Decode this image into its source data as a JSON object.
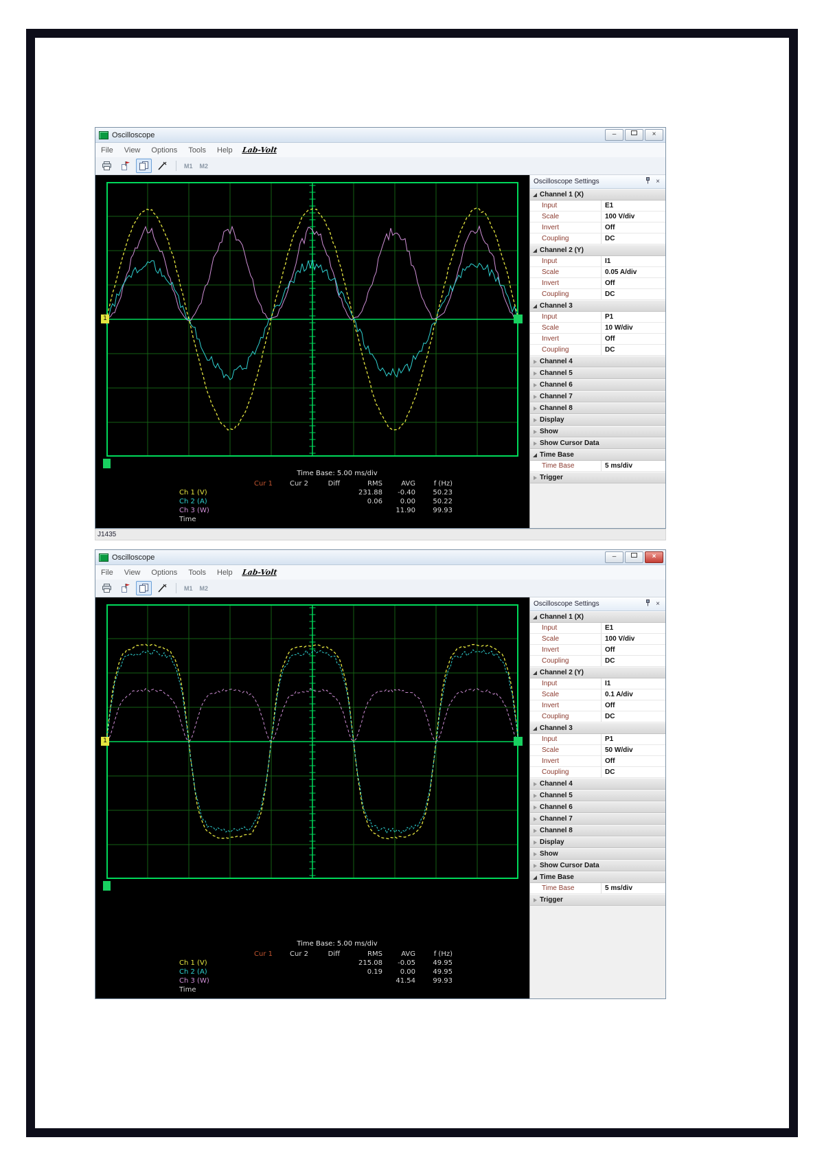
{
  "icons": {
    "minimize_glyph": "–",
    "close_glyph": "×"
  },
  "page": {
    "status_label": "J1435"
  },
  "palette": {
    "grid_bright": "#00d95a",
    "grid_dim": "#146114",
    "scope_bg": "#000000",
    "ch1_yellow": "#e6e640",
    "ch2_cyan": "#2fd0d0",
    "ch3_magenta": "#cf8fd6",
    "cursor1_orange": "#c1542f"
  },
  "windows": [
    {
      "title": "Oscilloscope",
      "menus": [
        "File",
        "View",
        "Options",
        "Tools",
        "Help"
      ],
      "logo_label": "Lab-Volt",
      "toolbar": {
        "m1_label": "M1",
        "m2_label": "M2"
      },
      "scope": {
        "trigger_marker": "1",
        "time_base_label": "Time Base: 5.00 ms/div",
        "table": {
          "headers": [
            "Cur 1",
            "Cur 2",
            "Diff",
            "RMS",
            "AVG",
            "f (Hz)"
          ],
          "rows": [
            {
              "label": "Ch 1 (V)",
              "color": "#e6e640",
              "cur1": "",
              "cur2": "",
              "diff": "",
              "rms": "231.88",
              "avg": "-0.40",
              "f": "50.23"
            },
            {
              "label": "Ch 2 (A)",
              "color": "#2fd0d0",
              "cur1": "",
              "cur2": "",
              "diff": "",
              "rms": "0.06",
              "avg": "0.00",
              "f": "50.22"
            },
            {
              "label": "Ch 3 (W)",
              "color": "#cf8fd6",
              "cur1": "",
              "cur2": "",
              "diff": "",
              "rms": "",
              "avg": "11.90",
              "f": "99.93"
            },
            {
              "label": "Time",
              "color": "#d9d9d9",
              "cur1": "",
              "cur2": "",
              "diff": "",
              "rms": "",
              "avg": "",
              "f": ""
            }
          ]
        }
      },
      "waveforms": [
        {
          "name": "ch3-power",
          "color": "#cf8fd6",
          "kind": "power",
          "amp_div": 2.6,
          "period_div": 4,
          "peak_div": 5,
          "shape_k": 0,
          "noise_div": 0.18,
          "dash": "",
          "width": 1
        },
        {
          "name": "ch2-current",
          "color": "#2fd0d0",
          "kind": "sine",
          "amp_div": 1.6,
          "period_div": 4,
          "peak_div": 5,
          "shape_k": 0,
          "noise_div": 0.16,
          "dash": "",
          "width": 1
        },
        {
          "name": "ch1-voltage",
          "color": "#e6e640",
          "kind": "sine",
          "amp_div": 3.2,
          "period_div": 4,
          "peak_div": 5,
          "shape_k": 0,
          "noise_div": 0.05,
          "dash": "4 3",
          "width": 1.3
        }
      ],
      "settings": {
        "title": "Oscilloscope Settings",
        "sections": [
          {
            "label": "Channel 1 (X)",
            "expanded": true,
            "props": [
              {
                "name": "Input",
                "value": "E1"
              },
              {
                "name": "Scale",
                "value": "100 V/div"
              },
              {
                "name": "Invert",
                "value": "Off"
              },
              {
                "name": "Coupling",
                "value": "DC"
              }
            ]
          },
          {
            "label": "Channel 2 (Y)",
            "expanded": true,
            "props": [
              {
                "name": "Input",
                "value": "I1"
              },
              {
                "name": "Scale",
                "value": "0.05 A/div"
              },
              {
                "name": "Invert",
                "value": "Off"
              },
              {
                "name": "Coupling",
                "value": "DC"
              }
            ]
          },
          {
            "label": "Channel 3",
            "expanded": true,
            "props": [
              {
                "name": "Input",
                "value": "P1"
              },
              {
                "name": "Scale",
                "value": "10 W/div"
              },
              {
                "name": "Invert",
                "value": "Off"
              },
              {
                "name": "Coupling",
                "value": "DC"
              }
            ]
          },
          {
            "label": "Channel 4",
            "expanded": false,
            "props": []
          },
          {
            "label": "Channel 5",
            "expanded": false,
            "props": []
          },
          {
            "label": "Channel 6",
            "expanded": false,
            "props": []
          },
          {
            "label": "Channel 7",
            "expanded": false,
            "props": []
          },
          {
            "label": "Channel 8",
            "expanded": false,
            "props": []
          },
          {
            "label": "Display",
            "expanded": false,
            "props": []
          },
          {
            "label": "Show",
            "expanded": false,
            "props": []
          },
          {
            "label": "Show Cursor Data",
            "expanded": false,
            "props": []
          },
          {
            "label": "Time Base",
            "expanded": true,
            "props": [
              {
                "name": "Time Base",
                "value": "5 ms/div"
              }
            ]
          },
          {
            "label": "Trigger",
            "expanded": false,
            "props": []
          }
        ]
      }
    },
    {
      "title": "Oscilloscope",
      "menus": [
        "File",
        "View",
        "Options",
        "Tools",
        "Help"
      ],
      "logo_label": "Lab-Volt",
      "toolbar": {
        "m1_label": "M1",
        "m2_label": "M2"
      },
      "scope": {
        "trigger_marker": "1",
        "time_base_label": "Time Base: 5.00 ms/div",
        "table": {
          "headers": [
            "Cur 1",
            "Cur 2",
            "Diff",
            "RMS",
            "AVG",
            "f (Hz)"
          ],
          "rows": [
            {
              "label": "Ch 1 (V)",
              "color": "#e6e640",
              "cur1": "",
              "cur2": "",
              "diff": "",
              "rms": "215.08",
              "avg": "-0.05",
              "f": "49.95"
            },
            {
              "label": "Ch 2 (A)",
              "color": "#2fd0d0",
              "cur1": "",
              "cur2": "",
              "diff": "",
              "rms": "0.19",
              "avg": "0.00",
              "f": "49.95"
            },
            {
              "label": "Ch 3 (W)",
              "color": "#cf8fd6",
              "cur1": "",
              "cur2": "",
              "diff": "",
              "rms": "",
              "avg": "41.54",
              "f": "99.93"
            },
            {
              "label": "Time",
              "color": "#d9d9d9",
              "cur1": "",
              "cur2": "",
              "diff": "",
              "rms": "",
              "avg": "",
              "f": ""
            }
          ]
        }
      },
      "waveforms": [
        {
          "name": "ch3-power",
          "color": "#cf8fd6",
          "kind": "power",
          "amp_div": 1.5,
          "period_div": 4,
          "peak_div": 5,
          "shape_k": 2.4,
          "noise_div": 0.05,
          "dash": "4 3",
          "width": 1
        },
        {
          "name": "ch1-voltage",
          "color": "#e6e640",
          "kind": "sine",
          "amp_div": 2.8,
          "period_div": 4,
          "peak_div": 5,
          "shape_k": 2.4,
          "noise_div": 0.04,
          "dash": "4 3",
          "width": 1.3
        },
        {
          "name": "ch2-current",
          "color": "#2fd0d0",
          "kind": "sine",
          "amp_div": 2.6,
          "period_div": 4,
          "peak_div": 5,
          "shape_k": 2.4,
          "noise_div": 0.08,
          "dash": "3 2",
          "width": 1
        }
      ],
      "settings": {
        "title": "Oscilloscope Settings",
        "sections": [
          {
            "label": "Channel 1 (X)",
            "expanded": true,
            "props": [
              {
                "name": "Input",
                "value": "E1"
              },
              {
                "name": "Scale",
                "value": "100 V/div"
              },
              {
                "name": "Invert",
                "value": "Off"
              },
              {
                "name": "Coupling",
                "value": "DC"
              }
            ]
          },
          {
            "label": "Channel 2 (Y)",
            "expanded": true,
            "props": [
              {
                "name": "Input",
                "value": "I1"
              },
              {
                "name": "Scale",
                "value": "0.1 A/div"
              },
              {
                "name": "Invert",
                "value": "Off"
              },
              {
                "name": "Coupling",
                "value": "DC"
              }
            ]
          },
          {
            "label": "Channel 3",
            "expanded": true,
            "props": [
              {
                "name": "Input",
                "value": "P1"
              },
              {
                "name": "Scale",
                "value": "50 W/div"
              },
              {
                "name": "Invert",
                "value": "Off"
              },
              {
                "name": "Coupling",
                "value": "DC"
              }
            ]
          },
          {
            "label": "Channel 4",
            "expanded": false,
            "props": []
          },
          {
            "label": "Channel 5",
            "expanded": false,
            "props": []
          },
          {
            "label": "Channel 6",
            "expanded": false,
            "props": []
          },
          {
            "label": "Channel 7",
            "expanded": false,
            "props": []
          },
          {
            "label": "Channel 8",
            "expanded": false,
            "props": []
          },
          {
            "label": "Display",
            "expanded": false,
            "props": []
          },
          {
            "label": "Show",
            "expanded": false,
            "props": []
          },
          {
            "label": "Show Cursor Data",
            "expanded": false,
            "props": []
          },
          {
            "label": "Time Base",
            "expanded": true,
            "props": [
              {
                "name": "Time Base",
                "value": "5 ms/div"
              }
            ]
          },
          {
            "label": "Trigger",
            "expanded": false,
            "props": []
          }
        ]
      }
    }
  ]
}
